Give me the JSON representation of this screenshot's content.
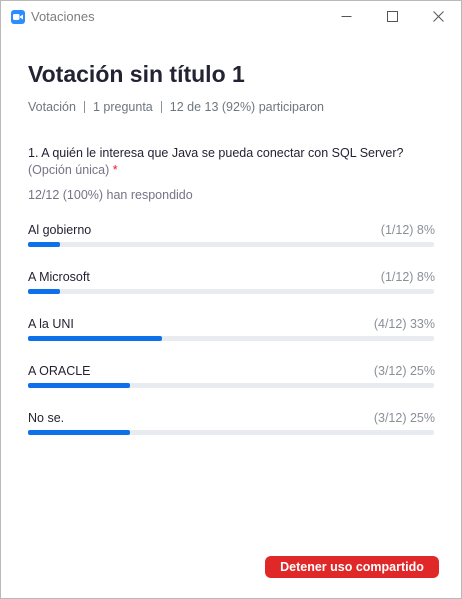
{
  "window": {
    "title": "Votaciones",
    "controls": [
      "minimize-icon",
      "maximize-icon",
      "close-icon"
    ]
  },
  "poll": {
    "title": "Votación sin título 1",
    "meta": {
      "type": "Votación",
      "questions": "1 pregunta",
      "participation": "12 de 13 (92%) participaron"
    },
    "question": {
      "text": "1. A quién le interesa que Java se pueda conectar con SQL Server?",
      "type": "(Opción única)",
      "required_mark": "*"
    },
    "answered": "12/12 (100%) han respondido",
    "options": [
      {
        "label": "Al gobierno",
        "result": "(1/12) 8%",
        "percent": 8
      },
      {
        "label": "A Microsoft",
        "result": "(1/12) 8%",
        "percent": 8
      },
      {
        "label": "A la UNI",
        "result": "(4/12) 33%",
        "percent": 33
      },
      {
        "label": "A ORACLE",
        "result": "(3/12) 25%",
        "percent": 25
      },
      {
        "label": "No se.",
        "result": "(3/12) 25%",
        "percent": 25
      }
    ]
  },
  "actions": {
    "stop_sharing_label": "Detener uso compartido"
  },
  "colors": {
    "accent": "#0e71eb",
    "danger": "#e02828",
    "app_icon": "#2d8cff"
  }
}
